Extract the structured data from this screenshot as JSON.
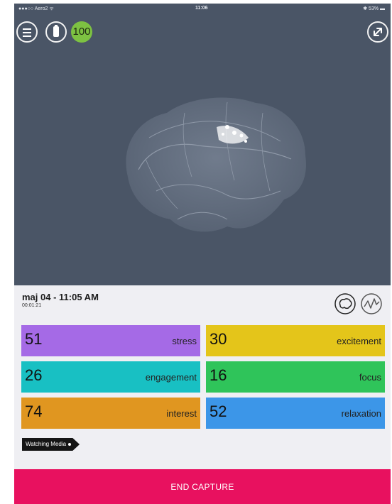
{
  "status_bar": {
    "carrier": "●●●○○ Aero2 ᯤ",
    "time": "11:06",
    "battery": "✱ 53% ▬"
  },
  "header": {
    "score": "100"
  },
  "session": {
    "title": "maj 04 - 11:05 AM",
    "duration": "00:01:21"
  },
  "metrics": [
    {
      "value": "51",
      "label": "stress",
      "color": "#a56ae6"
    },
    {
      "value": "30",
      "label": "excitement",
      "color": "#e4c51a"
    },
    {
      "value": "26",
      "label": "engagement",
      "color": "#18c0c3"
    },
    {
      "value": "16",
      "label": "focus",
      "color": "#2fc45a"
    },
    {
      "value": "74",
      "label": "interest",
      "color": "#e09620"
    },
    {
      "value": "52",
      "label": "relaxation",
      "color": "#3c96e8"
    }
  ],
  "tag": {
    "label": "Watching Media"
  },
  "end_button": {
    "label": "END CAPTURE"
  },
  "colors": {
    "viewer_bg": "#4a5566",
    "end_button": "#e8115f",
    "score_badge": "#7dc242"
  }
}
